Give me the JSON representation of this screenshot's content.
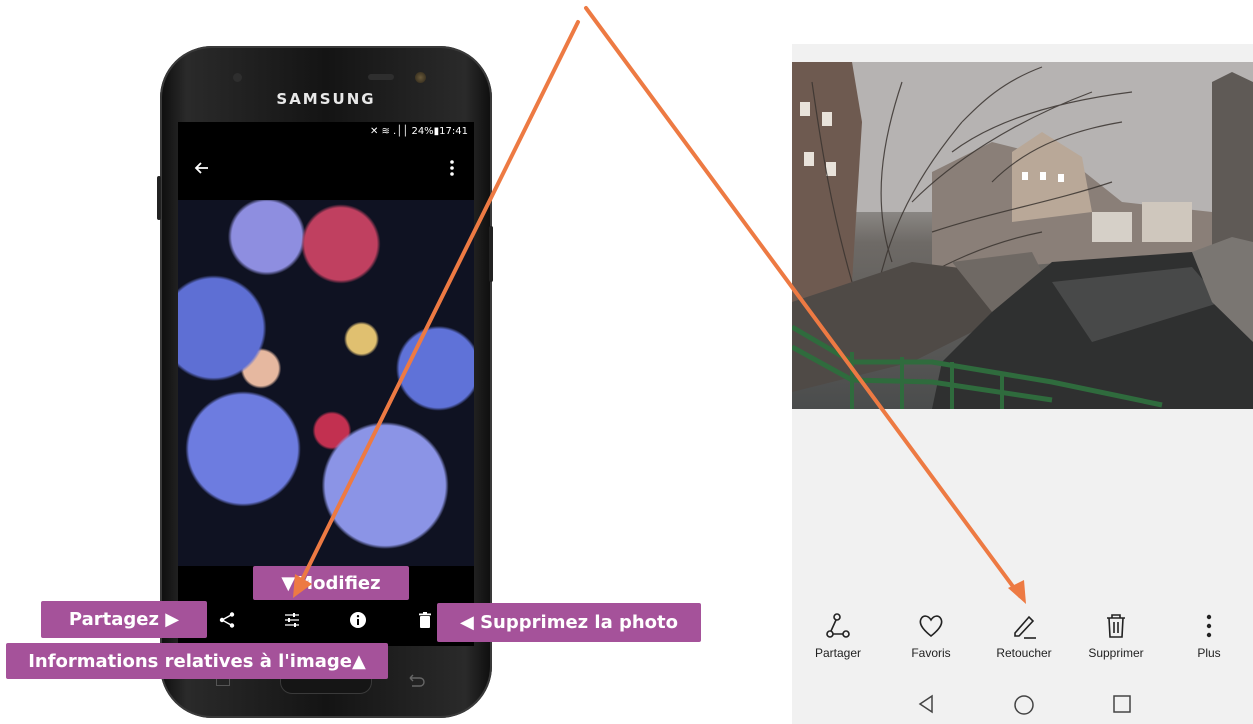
{
  "phone": {
    "brand": "SAMSUNG",
    "status_text": "✕ ≋ .││ 24%▮17:41",
    "callouts": {
      "modifiez": "▼Modifiez",
      "partagez": "Partagez ▶",
      "supprimez": "◀ Supprimez la photo",
      "info": "Informations relatives à l'image▲"
    }
  },
  "gallery": {
    "actions": [
      {
        "label": "Partager",
        "icon": "share-icon"
      },
      {
        "label": "Favoris",
        "icon": "heart-icon"
      },
      {
        "label": "Retoucher",
        "icon": "pencil-icon"
      },
      {
        "label": "Supprimer",
        "icon": "trash-icon"
      },
      {
        "label": "Plus",
        "icon": "more-vertical-icon"
      }
    ],
    "nav": [
      "back-triangle-icon",
      "home-circle-icon",
      "recents-square-icon"
    ]
  },
  "colors": {
    "callout": "#a5529a",
    "arrow": "#ed7a43",
    "gallery_bg": "#f1f1f1"
  }
}
